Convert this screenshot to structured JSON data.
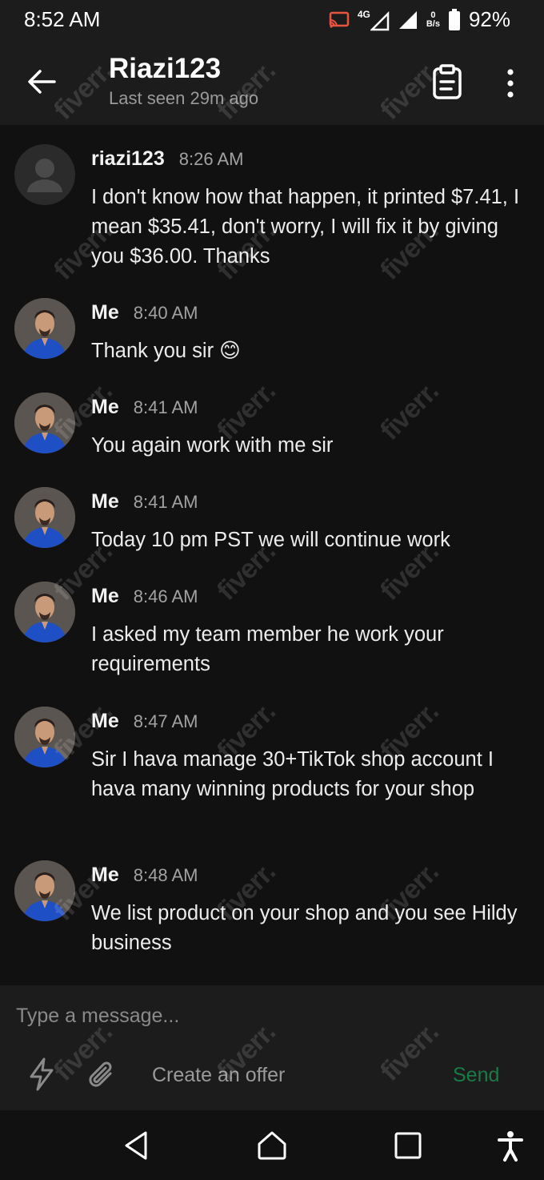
{
  "status_bar": {
    "time": "8:52 AM",
    "network_label": "4G",
    "data_speed_top": "0",
    "data_speed_unit": "B/s",
    "battery": "92%"
  },
  "header": {
    "contact_name": "Riazi123",
    "last_seen": "Last seen 29m ago",
    "icons": [
      "back-arrow-icon",
      "clipboard-icon",
      "more-vertical-icon"
    ]
  },
  "messages": [
    {
      "sender": "riazi123",
      "time": "8:26 AM",
      "avatar": "default",
      "text": "I don't know how that happen, it printed $7.41, I mean $35.41, don't worry, I will fix it by giving you $36.00. Thanks"
    },
    {
      "sender": "Me",
      "time": "8:40 AM",
      "avatar": "photo",
      "text": "Thank you sir 😊"
    },
    {
      "sender": "Me",
      "time": "8:41 AM",
      "avatar": "photo",
      "text": "You again work with me sir"
    },
    {
      "sender": "Me",
      "time": "8:41 AM",
      "avatar": "photo",
      "text": "Today 10 pm PST we will continue work"
    },
    {
      "sender": "Me",
      "time": "8:46 AM",
      "avatar": "photo",
      "text": "I asked my team member he work your requirements"
    },
    {
      "sender": "Me",
      "time": "8:47 AM",
      "avatar": "photo",
      "text": "Sir I hava manage 30+TikTok shop account I hava many winning products for your shop"
    },
    {
      "sender": "Me",
      "time": "8:48 AM",
      "avatar": "photo",
      "text": "We list product on your shop and you see Hildy business"
    }
  ],
  "composer": {
    "placeholder": "Type a message...",
    "create_offer": "Create an offer",
    "send": "Send",
    "send_color": "#1a7a45",
    "icons": [
      "lightning-icon",
      "paperclip-icon"
    ]
  },
  "nav_bar": {
    "icons": [
      "back-triangle-icon",
      "home-icon",
      "recents-icon",
      "accessibility-icon"
    ]
  },
  "watermark": "fiverr."
}
